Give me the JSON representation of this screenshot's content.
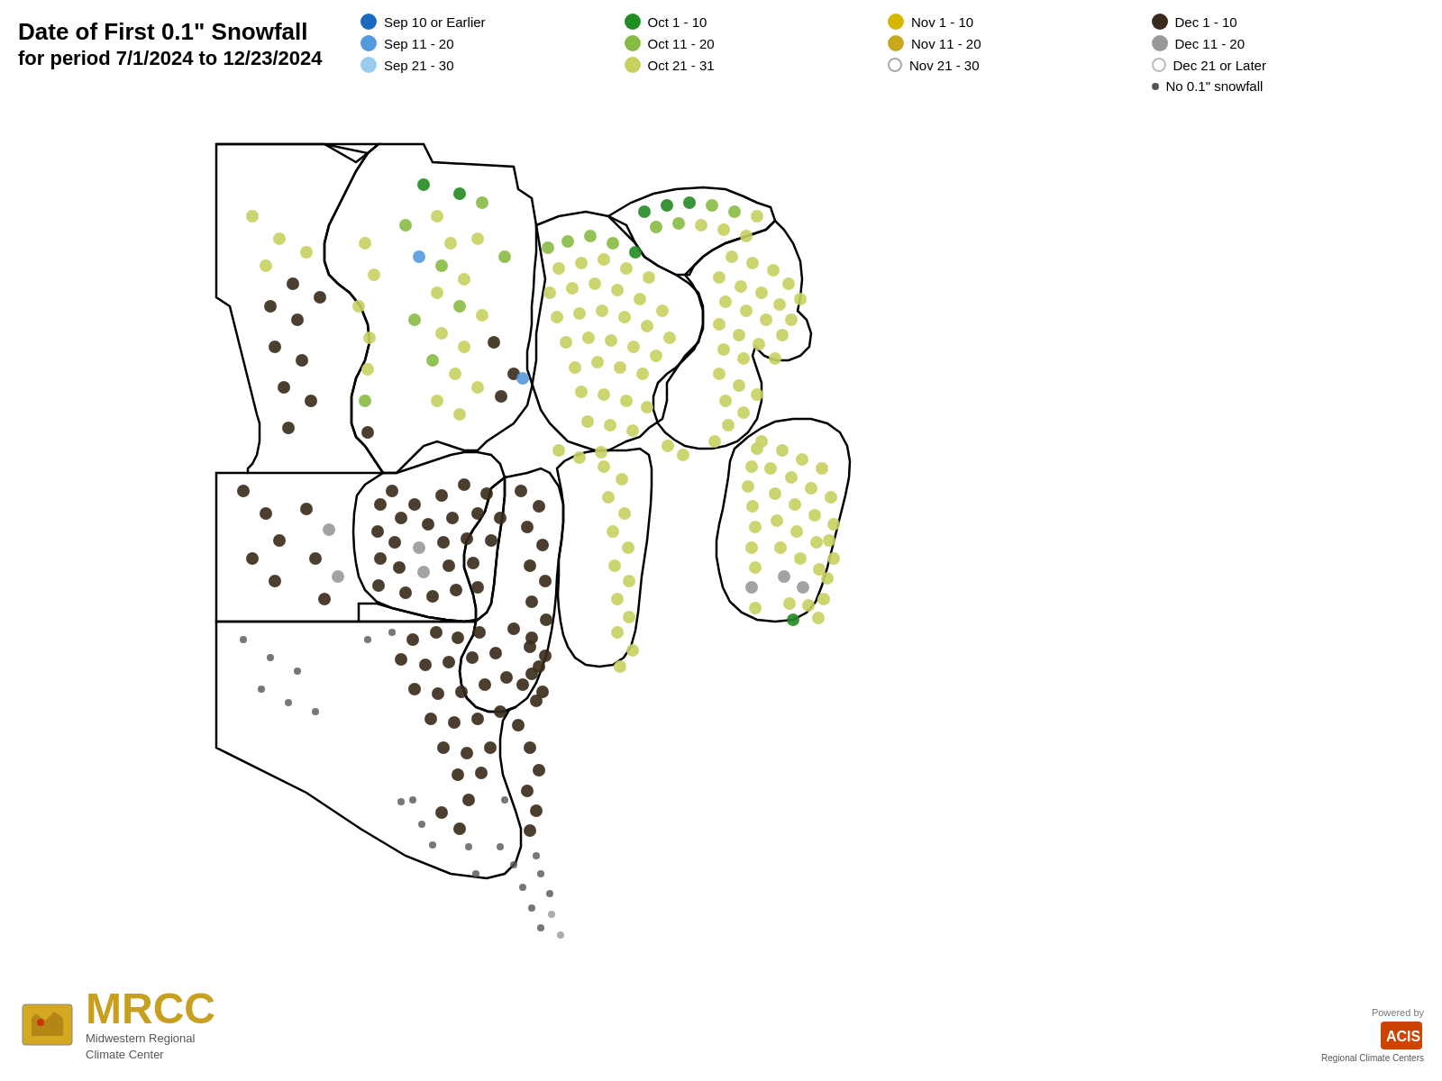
{
  "title": {
    "line1": "Date of First 0.1\" Snowfall",
    "line2": "for period 7/1/2024 to 12/23/2024"
  },
  "legend": {
    "items": [
      {
        "label": "Sep 10 or Earlier",
        "color": "#1a6abf",
        "type": "solid",
        "col": 1,
        "row": 1
      },
      {
        "label": "Oct 1 - 10",
        "color": "#228b22",
        "type": "solid",
        "col": 2,
        "row": 1
      },
      {
        "label": "Nov 1 - 10",
        "color": "#d4b800",
        "type": "solid",
        "col": 3,
        "row": 1
      },
      {
        "label": "Dec 1 - 10",
        "color": "#3a2a1a",
        "type": "solid",
        "col": 4,
        "row": 1
      },
      {
        "label": "Sep 11 - 20",
        "color": "#5599dd",
        "type": "solid",
        "col": 1,
        "row": 2
      },
      {
        "label": "Oct 11 - 20",
        "color": "#88bb44",
        "type": "solid",
        "col": 2,
        "row": 2
      },
      {
        "label": "Nov 11 - 20",
        "color": "#c8a820",
        "type": "solid",
        "col": 3,
        "row": 2
      },
      {
        "label": "Dec 11 - 20",
        "color": "#999999",
        "type": "solid",
        "col": 4,
        "row": 2
      },
      {
        "label": "Sep 21 - 30",
        "color": "#99ccee",
        "type": "solid",
        "col": 1,
        "row": 3
      },
      {
        "label": "Oct 21 - 31",
        "color": "#c8d060",
        "type": "solid",
        "col": 2,
        "row": 3
      },
      {
        "label": "Nov 21 - 30",
        "color": "#ddd8a0",
        "type": "outline",
        "col": 3,
        "row": 3
      },
      {
        "label": "Dec 21 or Later",
        "color": "#cccccc",
        "type": "outline",
        "col": 4,
        "row": 3
      },
      {
        "label": "No 0.1\" snowfall",
        "color": "#555",
        "type": "small",
        "col": 4,
        "row": 4
      }
    ]
  },
  "mrcc": {
    "name": "MRCC",
    "full_name": "Midwestern Regional",
    "full_name2": "Climate Center"
  },
  "acis": {
    "powered_by": "Powered by",
    "name": "ACIS",
    "sub": "Regional Climate Centers"
  }
}
